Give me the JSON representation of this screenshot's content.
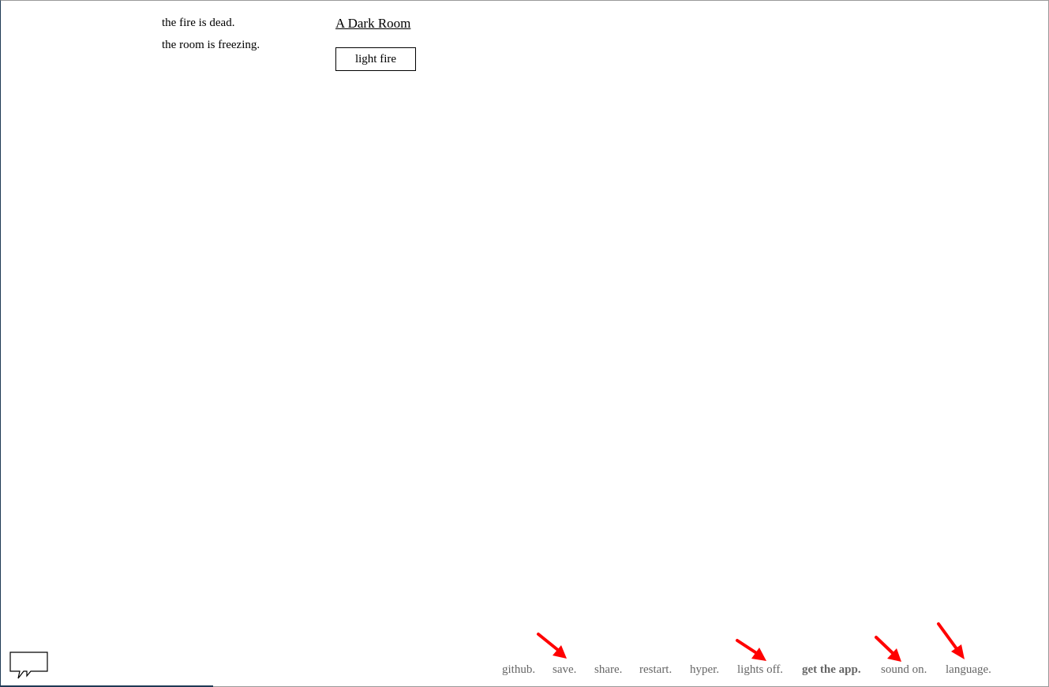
{
  "notifications": [
    "the fire is dead.",
    "the room is freezing."
  ],
  "location": {
    "title": "A Dark Room"
  },
  "actions": {
    "light_fire": "light fire"
  },
  "menu": {
    "github": "github.",
    "save": "save.",
    "share": "share.",
    "restart": "restart.",
    "hyper": "hyper.",
    "lights": "lights off.",
    "app": "get the app.",
    "sound": "sound on.",
    "language": "language."
  },
  "icons": {
    "chat": "speech-bubble-icon",
    "arrow": "red-arrow-icon"
  },
  "colors": {
    "text": "#000000",
    "menu_text": "#666666",
    "arrow": "#ff0000",
    "frame": "#9a9a9a"
  }
}
